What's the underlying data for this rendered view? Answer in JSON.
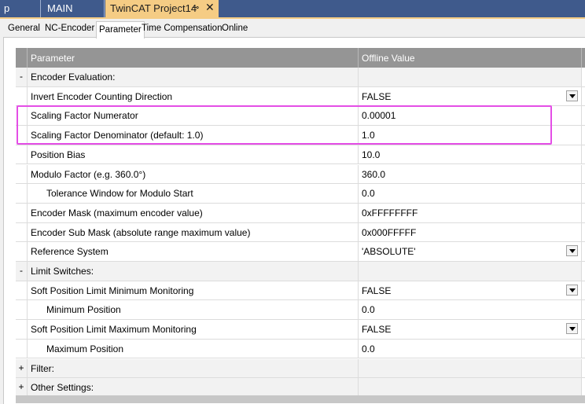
{
  "doc_tabs": {
    "tab1": "p",
    "tab2": "MAIN",
    "active": "TwinCAT Project14",
    "pin_glyph": "⊸",
    "close_glyph": "✕"
  },
  "page_tabs": [
    "General",
    "NC-Encoder",
    "Parameter",
    "Time Compensation",
    "Online"
  ],
  "grid": {
    "header": {
      "parameter": "Parameter",
      "value": "Offline Value"
    },
    "rows": [
      {
        "gutter": "-",
        "param": "Encoder Evaluation:",
        "value": "",
        "group": true
      },
      {
        "gutter": "",
        "param": "Invert Encoder Counting Direction",
        "value": "FALSE",
        "dropdown": true
      },
      {
        "gutter": "",
        "param": "Scaling Factor Numerator",
        "value": "0.00001"
      },
      {
        "gutter": "",
        "param": "Scaling Factor Denominator (default: 1.0)",
        "value": "1.0"
      },
      {
        "gutter": "",
        "param": "Position Bias",
        "value": "10.0"
      },
      {
        "gutter": "",
        "param": "Modulo Factor (e.g. 360.0°)",
        "value": "360.0"
      },
      {
        "gutter": "",
        "param": "Tolerance Window for Modulo Start",
        "value": "0.0",
        "indent": true
      },
      {
        "gutter": "",
        "param": "Encoder Mask (maximum encoder value)",
        "value": "0xFFFFFFFF"
      },
      {
        "gutter": "",
        "param": "Encoder Sub Mask (absolute range maximum value)",
        "value": "0x000FFFFF"
      },
      {
        "gutter": "",
        "param": "Reference System",
        "value": "'ABSOLUTE'",
        "dropdown": true
      },
      {
        "gutter": "-",
        "param": "Limit Switches:",
        "value": "",
        "group": true
      },
      {
        "gutter": "",
        "param": "Soft Position Limit Minimum Monitoring",
        "value": "FALSE",
        "dropdown": true
      },
      {
        "gutter": "",
        "param": "Minimum Position",
        "value": "0.0",
        "indent": true
      },
      {
        "gutter": "",
        "param": "Soft Position Limit Maximum Monitoring",
        "value": "FALSE",
        "dropdown": true
      },
      {
        "gutter": "",
        "param": "Maximum Position",
        "value": "0.0",
        "indent": true
      },
      {
        "gutter": "+",
        "param": "Filter:",
        "value": "",
        "group": true
      },
      {
        "gutter": "+",
        "param": "Other Settings:",
        "value": "",
        "group": true
      }
    ]
  },
  "colors": {
    "doc_tab_strip": "#3f5a8c",
    "active_doc_tab": "#f5cc84",
    "grid_header": "#959595",
    "highlight": "#e44ee6"
  }
}
